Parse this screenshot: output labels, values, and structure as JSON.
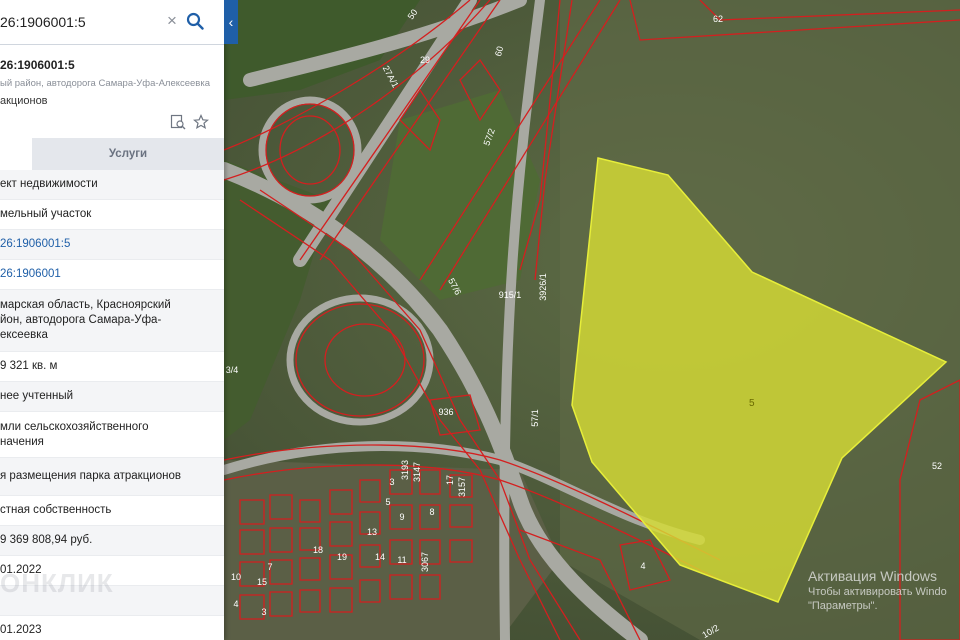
{
  "search": {
    "value": "26:1906001:5"
  },
  "panel": {
    "collapse_icon": "chevron-left-icon",
    "object_number": "26:1906001:5",
    "address_short": "ый район, автодорога Самара-Уфа-Алексеевка",
    "permitted_use_short": "акционов",
    "tabs": [
      {
        "label": ""
      },
      {
        "label": "Услуги"
      }
    ],
    "rows": [
      {
        "text": "ект недвижимости"
      },
      {
        "text": "мельный участок"
      },
      {
        "text": "26:1906001:5"
      },
      {
        "text": "26:1906001"
      },
      {
        "text": "марская область, Красноярский\nйон, автодорога Самара-Уфа-\nексеевка"
      },
      {
        "text": "9 321 кв. м"
      },
      {
        "text": "нее учтенный"
      },
      {
        "text": "мли сельскохозяйственного\nначения"
      },
      {
        "text": "я размещения парка атракционов"
      },
      {
        "text": "стная собственность"
      },
      {
        "text": "9 369 808,94 руб."
      },
      {
        "text": "01.2022"
      },
      {
        "text": ""
      },
      {
        "text": "01.2023"
      }
    ]
  },
  "map": {
    "selected_parcel_label": "5",
    "parcel_labels": [
      "62",
      "50",
      "29",
      "27А/1",
      "60",
      "57/2",
      "57/6",
      "915/1",
      "3926/1",
      "57/1",
      "936",
      "3/4",
      "52",
      "4",
      "3193",
      "3147",
      "3157",
      "17",
      "3",
      "5",
      "9",
      "13",
      "14",
      "11",
      "18",
      "19",
      "3067",
      "8",
      "10",
      "7",
      "15",
      "4",
      "10/2",
      "3"
    ]
  },
  "watermark": "ОНКЛИК",
  "activation": {
    "title": "Активация Windows",
    "line": "Чтобы активировать Windo",
    "line2": "\"Параметры\"."
  }
}
